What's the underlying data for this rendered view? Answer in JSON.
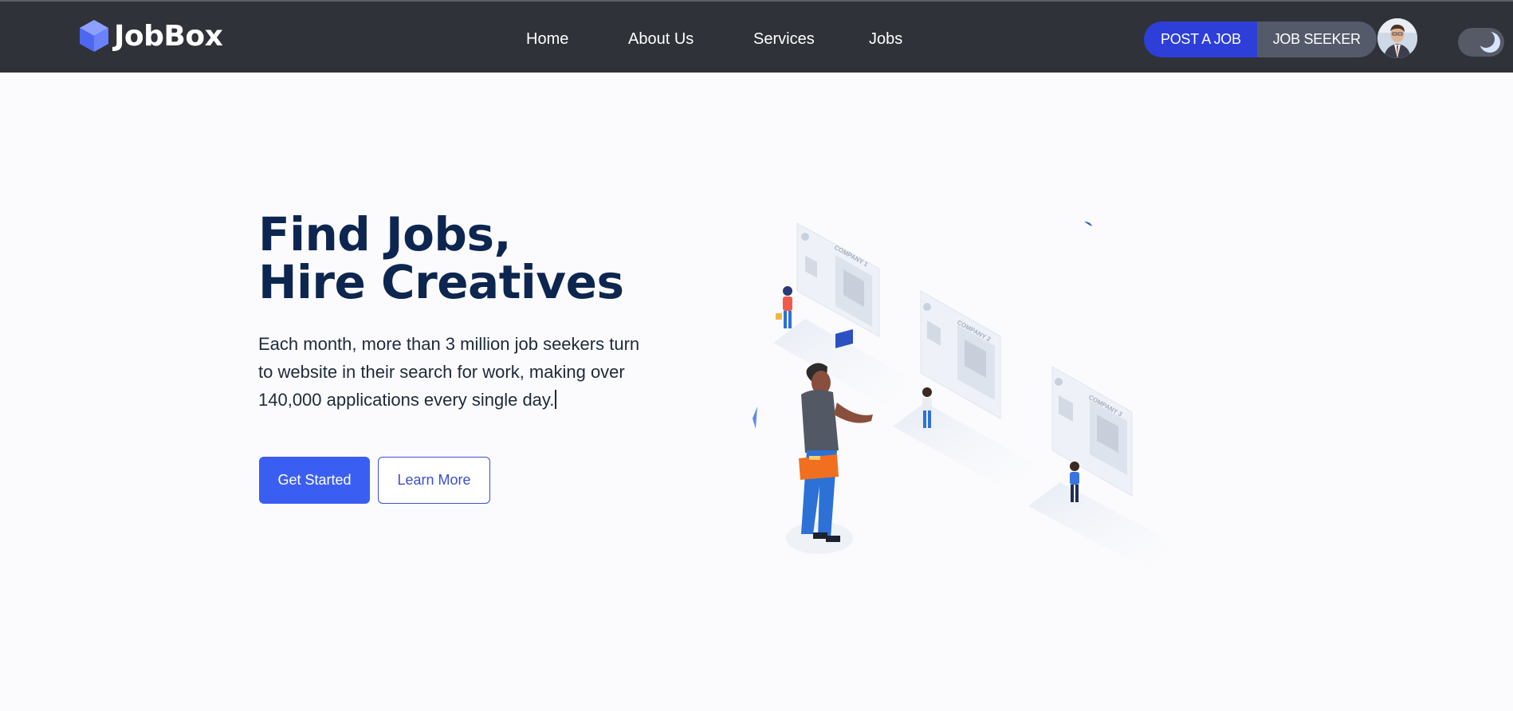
{
  "brand": {
    "name": "JobBox",
    "accent": "#3b5ef2"
  },
  "nav": {
    "links": [
      {
        "label": "Home"
      },
      {
        "label": "About Us"
      },
      {
        "label": "Services"
      },
      {
        "label": "Jobs"
      }
    ],
    "post_job_label": "POST A JOB",
    "job_seeker_label": "JOB SEEKER",
    "avatar_icon": "user-avatar",
    "theme_toggle_icon": "moon-icon"
  },
  "hero": {
    "title_line1": "Find Jobs,",
    "title_line2": "Hire Creatives",
    "description": "Each month, more than 3 million job seekers turn to website in their search for work, making over 140,000 applications every single day.",
    "get_started_label": "Get Started",
    "learn_more_label": "Learn More"
  },
  "illustration": {
    "cards": [
      {
        "label": "COMPANY 1"
      },
      {
        "label": "COMPANY 2"
      },
      {
        "label": "COMPANY 3"
      }
    ]
  },
  "colors": {
    "navbar_bg": "#2f3238",
    "post_job_bg": "#2d3fd8",
    "job_seeker_bg": "#555a6b",
    "title_color": "#0d2650"
  }
}
